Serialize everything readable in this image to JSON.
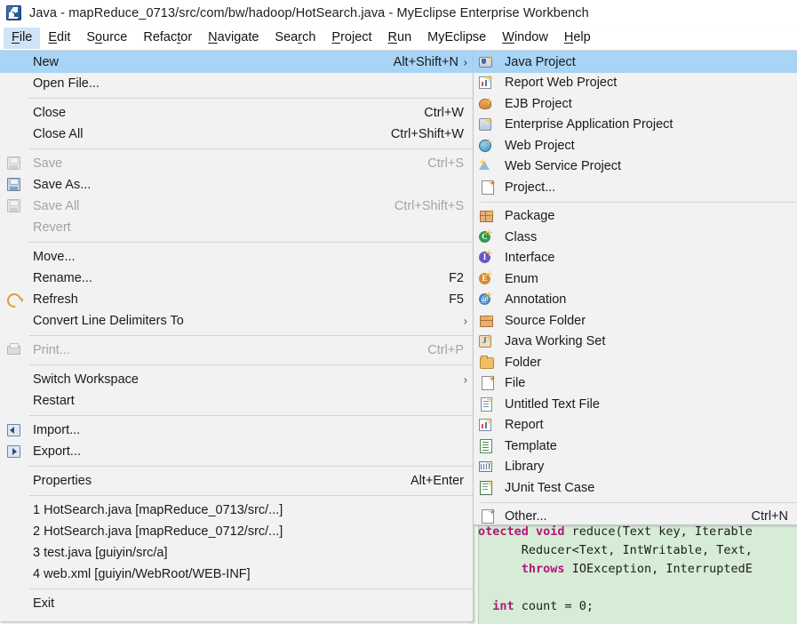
{
  "window": {
    "title": "Java - mapReduce_0713/src/com/bw/hadoop/HotSearch.java - MyEclipse Enterprise Workbench",
    "app_icon": "myeclipse-icon"
  },
  "menubar": {
    "items": [
      {
        "label": "File",
        "mnemonic_index": 0,
        "active": true
      },
      {
        "label": "Edit",
        "mnemonic_index": 0,
        "active": false
      },
      {
        "label": "Source",
        "mnemonic_index": 1,
        "active": false
      },
      {
        "label": "Refactor",
        "mnemonic_index": 5,
        "active": false
      },
      {
        "label": "Navigate",
        "mnemonic_index": 0,
        "active": false
      },
      {
        "label": "Search",
        "mnemonic_index": 3,
        "active": false
      },
      {
        "label": "Project",
        "mnemonic_index": 0,
        "active": false
      },
      {
        "label": "Run",
        "mnemonic_index": 0,
        "active": false
      },
      {
        "label": "MyEclipse",
        "mnemonic_index": -1,
        "active": false
      },
      {
        "label": "Window",
        "mnemonic_index": 0,
        "active": false
      },
      {
        "label": "Help",
        "mnemonic_index": 0,
        "active": false
      }
    ]
  },
  "file_menu": {
    "groups": [
      {
        "items": [
          {
            "label": "New",
            "accel": "Alt+Shift+N",
            "icon": "none",
            "submenu": true,
            "disabled": false,
            "highlighted": true
          },
          {
            "label": "Open File...",
            "accel": "",
            "icon": "none",
            "submenu": false,
            "disabled": false,
            "highlighted": false
          }
        ]
      },
      {
        "items": [
          {
            "label": "Close",
            "accel": "Ctrl+W",
            "icon": "none",
            "submenu": false,
            "disabled": false,
            "highlighted": false
          },
          {
            "label": "Close All",
            "accel": "Ctrl+Shift+W",
            "icon": "none",
            "submenu": false,
            "disabled": false,
            "highlighted": false
          }
        ]
      },
      {
        "items": [
          {
            "label": "Save",
            "accel": "Ctrl+S",
            "icon": "save-icon-disabled",
            "submenu": false,
            "disabled": true,
            "highlighted": false
          },
          {
            "label": "Save As...",
            "accel": "",
            "icon": "save-as-icon",
            "submenu": false,
            "disabled": false,
            "highlighted": false
          },
          {
            "label": "Save All",
            "accel": "Ctrl+Shift+S",
            "icon": "save-all-icon-disabled",
            "submenu": false,
            "disabled": true,
            "highlighted": false
          },
          {
            "label": "Revert",
            "accel": "",
            "icon": "none",
            "submenu": false,
            "disabled": true,
            "highlighted": false
          }
        ]
      },
      {
        "items": [
          {
            "label": "Move...",
            "accel": "",
            "icon": "none",
            "submenu": false,
            "disabled": false,
            "highlighted": false
          },
          {
            "label": "Rename...",
            "accel": "F2",
            "icon": "none",
            "submenu": false,
            "disabled": false,
            "highlighted": false
          },
          {
            "label": "Refresh",
            "accel": "F5",
            "icon": "refresh-icon",
            "submenu": false,
            "disabled": false,
            "highlighted": false
          },
          {
            "label": "Convert Line Delimiters To",
            "accel": "",
            "icon": "none",
            "submenu": true,
            "disabled": false,
            "highlighted": false
          }
        ]
      },
      {
        "items": [
          {
            "label": "Print...",
            "accel": "Ctrl+P",
            "icon": "printer-icon-disabled",
            "submenu": false,
            "disabled": true,
            "highlighted": false
          }
        ]
      },
      {
        "items": [
          {
            "label": "Switch Workspace",
            "accel": "",
            "icon": "none",
            "submenu": true,
            "disabled": false,
            "highlighted": false
          },
          {
            "label": "Restart",
            "accel": "",
            "icon": "none",
            "submenu": false,
            "disabled": false,
            "highlighted": false
          }
        ]
      },
      {
        "items": [
          {
            "label": "Import...",
            "accel": "",
            "icon": "import-icon",
            "submenu": false,
            "disabled": false,
            "highlighted": false
          },
          {
            "label": "Export...",
            "accel": "",
            "icon": "export-icon",
            "submenu": false,
            "disabled": false,
            "highlighted": false
          }
        ]
      },
      {
        "items": [
          {
            "label": "Properties",
            "accel": "Alt+Enter",
            "icon": "none",
            "submenu": false,
            "disabled": false,
            "highlighted": false
          }
        ]
      },
      {
        "items": [
          {
            "label": "1 HotSearch.java  [mapReduce_0713/src/...]",
            "accel": "",
            "icon": "none",
            "submenu": false,
            "disabled": false,
            "highlighted": false
          },
          {
            "label": "2 HotSearch.java  [mapReduce_0712/src/...]",
            "accel": "",
            "icon": "none",
            "submenu": false,
            "disabled": false,
            "highlighted": false
          },
          {
            "label": "3 test.java  [guiyin/src/a]",
            "accel": "",
            "icon": "none",
            "submenu": false,
            "disabled": false,
            "highlighted": false
          },
          {
            "label": "4 web.xml  [guiyin/WebRoot/WEB-INF]",
            "accel": "",
            "icon": "none",
            "submenu": false,
            "disabled": false,
            "highlighted": false
          }
        ]
      },
      {
        "items": [
          {
            "label": "Exit",
            "accel": "",
            "icon": "none",
            "submenu": false,
            "disabled": false,
            "highlighted": false
          }
        ]
      }
    ]
  },
  "new_submenu": {
    "groups": [
      {
        "items": [
          {
            "label": "Java Project",
            "accel": "",
            "icon": "java-project-icon",
            "highlighted": true
          },
          {
            "label": "Report Web Project",
            "accel": "",
            "icon": "report-web-project-icon",
            "highlighted": false
          },
          {
            "label": "EJB Project",
            "accel": "",
            "icon": "ejb-project-icon",
            "highlighted": false
          },
          {
            "label": "Enterprise Application Project",
            "accel": "",
            "icon": "enterprise-application-project-icon",
            "highlighted": false
          },
          {
            "label": "Web Project",
            "accel": "",
            "icon": "web-project-icon",
            "highlighted": false
          },
          {
            "label": "Web Service Project",
            "accel": "",
            "icon": "web-service-project-icon",
            "highlighted": false
          },
          {
            "label": "Project...",
            "accel": "",
            "icon": "project-icon",
            "highlighted": false
          }
        ]
      },
      {
        "items": [
          {
            "label": "Package",
            "accel": "",
            "icon": "package-icon",
            "highlighted": false
          },
          {
            "label": "Class",
            "accel": "",
            "icon": "class-icon",
            "highlighted": false
          },
          {
            "label": "Interface",
            "accel": "",
            "icon": "interface-icon",
            "highlighted": false
          },
          {
            "label": "Enum",
            "accel": "",
            "icon": "enum-icon",
            "highlighted": false
          },
          {
            "label": "Annotation",
            "accel": "",
            "icon": "annotation-icon",
            "highlighted": false
          },
          {
            "label": "Source Folder",
            "accel": "",
            "icon": "source-folder-icon",
            "highlighted": false
          },
          {
            "label": "Java Working Set",
            "accel": "",
            "icon": "java-working-set-icon",
            "highlighted": false
          },
          {
            "label": "Folder",
            "accel": "",
            "icon": "folder-icon",
            "highlighted": false
          },
          {
            "label": "File",
            "accel": "",
            "icon": "file-icon",
            "highlighted": false
          },
          {
            "label": "Untitled Text File",
            "accel": "",
            "icon": "untitled-text-file-icon",
            "highlighted": false
          },
          {
            "label": "Report",
            "accel": "",
            "icon": "report-icon",
            "highlighted": false
          },
          {
            "label": "Template",
            "accel": "",
            "icon": "template-icon",
            "highlighted": false
          },
          {
            "label": "Library",
            "accel": "",
            "icon": "library-icon",
            "highlighted": false
          },
          {
            "label": "JUnit Test Case",
            "accel": "",
            "icon": "junit-test-case-icon",
            "highlighted": false
          }
        ]
      },
      {
        "items": [
          {
            "label": "Other...",
            "accel": "Ctrl+N",
            "icon": "other-icon",
            "highlighted": false
          }
        ]
      }
    ]
  },
  "editor": {
    "code_lines": [
      {
        "segments": [
          {
            "t": "otected void",
            "k": true
          },
          {
            "t": " reduce(Text key, Iterable",
            "k": false
          }
        ]
      },
      {
        "segments": [
          {
            "t": "      Reducer<Text, IntWritable, Text,",
            "k": false
          }
        ]
      },
      {
        "segments": [
          {
            "t": "      ",
            "k": false
          },
          {
            "t": "throws",
            "k": true
          },
          {
            "t": " IOException, InterruptedE",
            "k": false
          }
        ]
      },
      {
        "segments": [
          {
            "t": "",
            "k": false
          }
        ]
      },
      {
        "segments": [
          {
            "t": "  ",
            "k": false
          },
          {
            "t": "int",
            "k": true
          },
          {
            "t": " count = 0;",
            "k": false
          }
        ]
      }
    ]
  },
  "colors": {
    "highlight": "#a8d4f5",
    "menubar_active": "#cfe4f7",
    "menu_bg": "#f2f2f2",
    "code_bg": "#d6ecd6",
    "keyword": "#b5157a"
  }
}
